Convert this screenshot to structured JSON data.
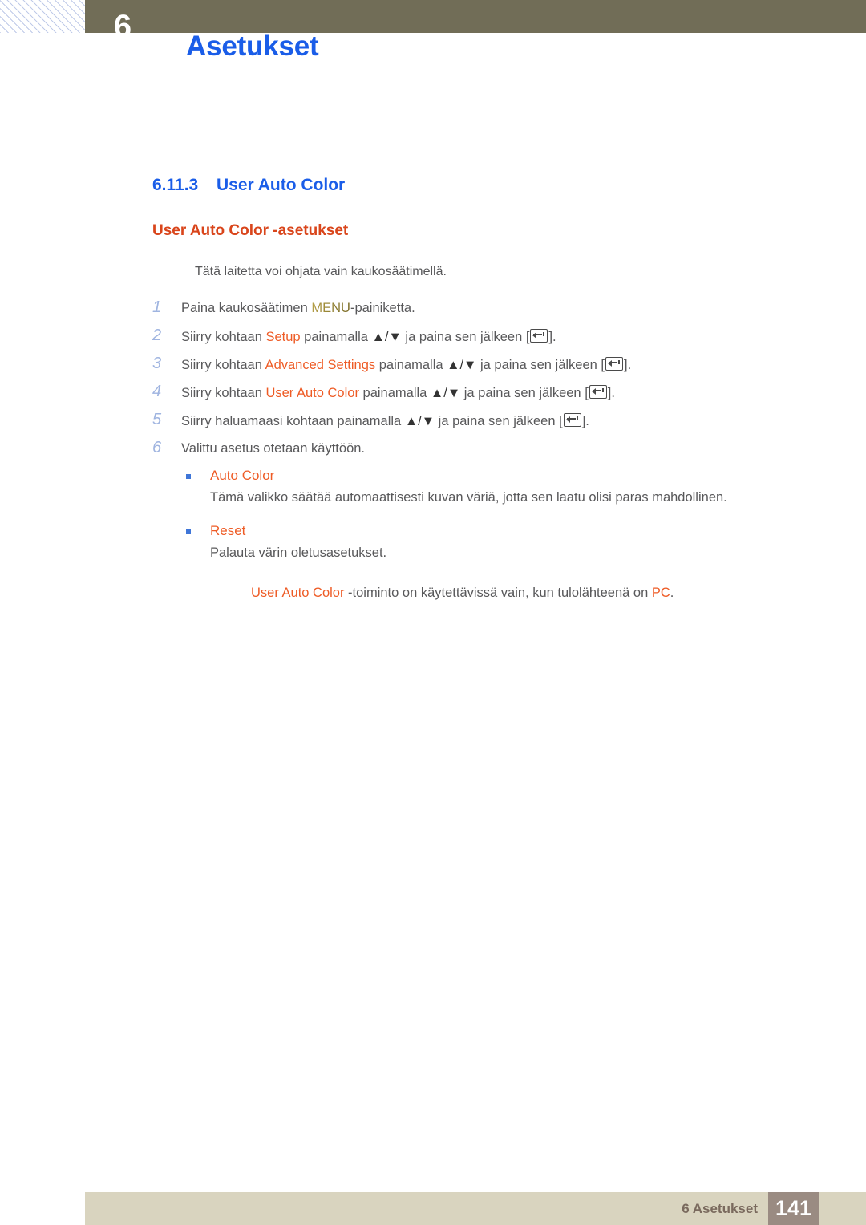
{
  "header": {
    "chapter_badge": "6",
    "running_title": "Asetukset",
    "bar_color": "#716d57"
  },
  "section": {
    "number": "6.11.3",
    "title": "User Auto Color",
    "subtitle": "User Auto Color -asetukset",
    "heading_color": "#1a5de8",
    "subtitle_color": "#d9451b"
  },
  "intro_note": "Tätä laitetta voi ohjata vain kaukosäätimellä.",
  "steps": [
    {
      "num": "1",
      "parts": [
        {
          "t": "Paina kaukosäätimen ",
          "style": "plain"
        },
        {
          "t": "MENU",
          "style": "gold"
        },
        {
          "t": "-painiketta.",
          "style": "plain"
        }
      ]
    },
    {
      "num": "2",
      "parts": [
        {
          "t": "Siirry kohtaan ",
          "style": "plain"
        },
        {
          "t": "Setup",
          "style": "orange"
        },
        {
          "t": " painamalla ",
          "style": "plain"
        },
        {
          "t": "▲/▼",
          "style": "arrows"
        },
        {
          "t": " ja paina sen jälkeen [",
          "style": "plain"
        },
        {
          "t": "",
          "style": "enter"
        },
        {
          "t": "].",
          "style": "plain"
        }
      ]
    },
    {
      "num": "3",
      "parts": [
        {
          "t": "Siirry kohtaan ",
          "style": "plain"
        },
        {
          "t": "Advanced Settings",
          "style": "orange"
        },
        {
          "t": " painamalla ",
          "style": "plain"
        },
        {
          "t": "▲/▼",
          "style": "arrows"
        },
        {
          "t": " ja paina sen jälkeen [",
          "style": "plain"
        },
        {
          "t": "",
          "style": "enter"
        },
        {
          "t": "].",
          "style": "plain"
        }
      ]
    },
    {
      "num": "4",
      "parts": [
        {
          "t": "Siirry kohtaan ",
          "style": "plain"
        },
        {
          "t": "User Auto Color",
          "style": "orange"
        },
        {
          "t": " painamalla ",
          "style": "plain"
        },
        {
          "t": "▲/▼",
          "style": "arrows"
        },
        {
          "t": " ja paina sen jälkeen [",
          "style": "plain"
        },
        {
          "t": "",
          "style": "enter"
        },
        {
          "t": "].",
          "style": "plain"
        }
      ]
    },
    {
      "num": "5",
      "parts": [
        {
          "t": "Siirry haluamaasi kohtaan painamalla ",
          "style": "plain"
        },
        {
          "t": "▲/▼",
          "style": "arrows"
        },
        {
          "t": " ja paina sen jälkeen [",
          "style": "plain"
        },
        {
          "t": "",
          "style": "enter"
        },
        {
          "t": "].",
          "style": "plain"
        }
      ]
    },
    {
      "num": "6",
      "parts": [
        {
          "t": "Valittu asetus otetaan käyttöön.",
          "style": "plain"
        }
      ]
    }
  ],
  "bullets": [
    {
      "label": "Auto Color",
      "desc": "Tämä valikko säätää automaattisesti kuvan väriä, jotta sen laatu olisi paras mahdollinen."
    },
    {
      "label": "Reset",
      "desc": "Palauta värin oletusasetukset."
    }
  ],
  "foot_note": {
    "parts": [
      {
        "t": "User Auto Color",
        "style": "orange"
      },
      {
        "t": " -toiminto on käytettävissä vain, kun tulolähteenä on ",
        "style": "plain"
      },
      {
        "t": "PC",
        "style": "orange"
      },
      {
        "t": ".",
        "style": "plain"
      }
    ]
  },
  "footer": {
    "chapter_label": "6 Asetukset",
    "page_number": "141",
    "band_color": "#d9d4bf",
    "page_box_color": "#9a8b82"
  }
}
